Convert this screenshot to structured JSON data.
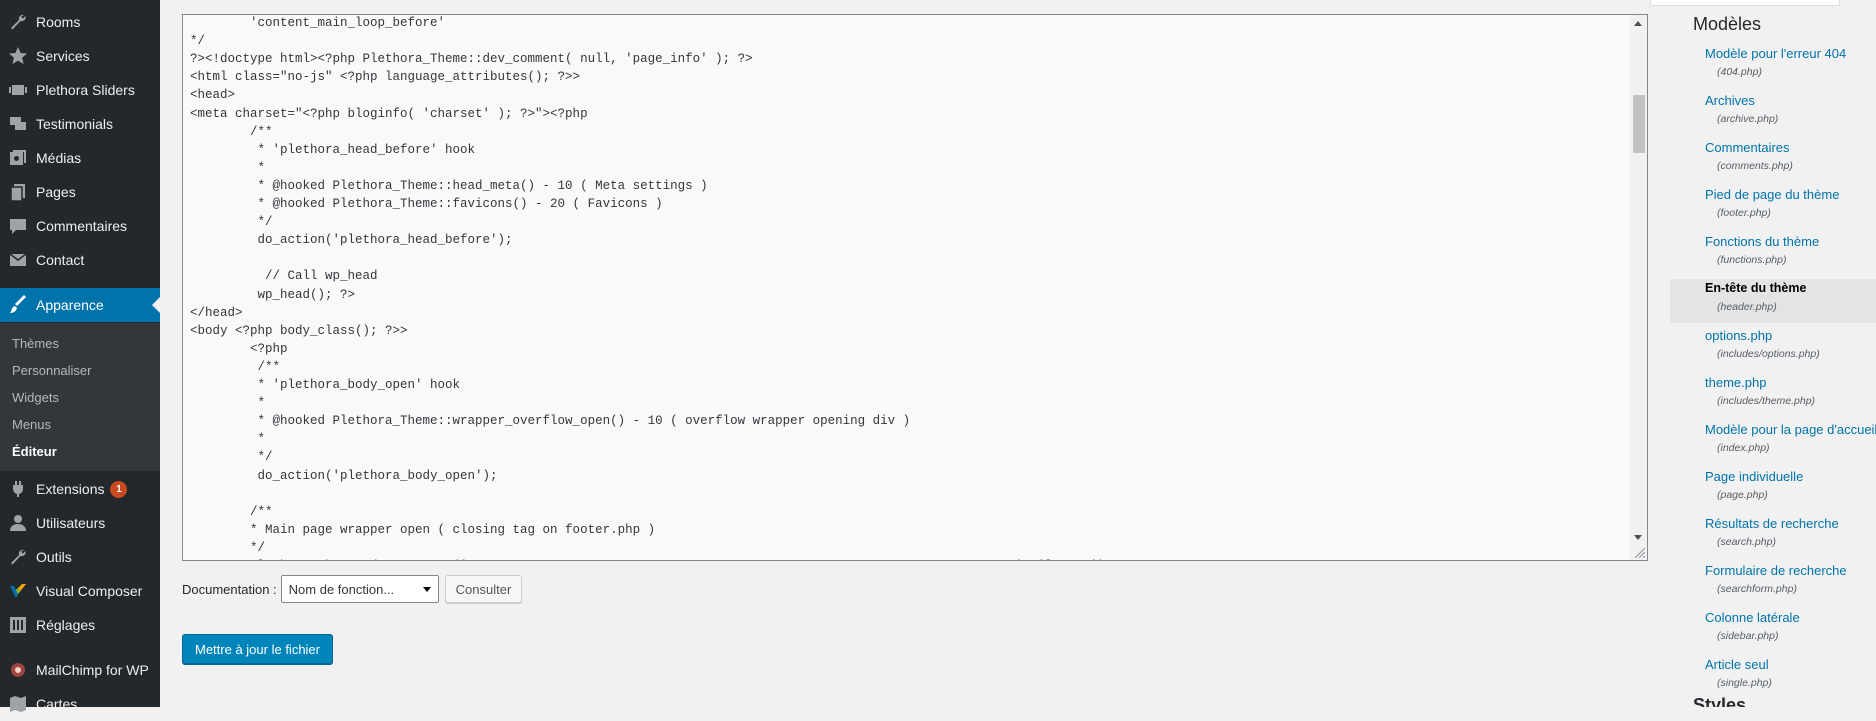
{
  "sidebar": {
    "items": [
      {
        "label": "Rooms",
        "icon": "wrench-icon"
      },
      {
        "label": "Services",
        "icon": "star-icon"
      },
      {
        "label": "Plethora Sliders",
        "icon": "slides-icon"
      },
      {
        "label": "Testimonials",
        "icon": "quote-icon"
      },
      {
        "label": "Médias",
        "icon": "media-icon"
      },
      {
        "label": "Pages",
        "icon": "pages-icon"
      },
      {
        "label": "Commentaires",
        "icon": "comment-icon"
      },
      {
        "label": "Contact",
        "icon": "mail-icon"
      },
      {
        "label": "Apparence",
        "icon": "brush-icon"
      },
      {
        "label": "Extensions",
        "icon": "plugin-icon",
        "badge": "1"
      },
      {
        "label": "Utilisateurs",
        "icon": "user-icon"
      },
      {
        "label": "Outils",
        "icon": "tools-icon"
      },
      {
        "label": "Visual Composer",
        "icon": "visual-composer-icon"
      },
      {
        "label": "Réglages",
        "icon": "settings-icon"
      },
      {
        "label": "MailChimp for WP",
        "icon": "mailchimp-icon"
      },
      {
        "label": "Cartes",
        "icon": "map-icon"
      }
    ],
    "submenu": [
      "Thèmes",
      "Personnaliser",
      "Widgets",
      "Menus",
      "Éditeur"
    ]
  },
  "editor": {
    "lines": [
      "        'content_main_loop_before'",
      "*/",
      "?><!doctype html><?php Plethora_Theme::dev_comment( null, 'page_info' ); ?>",
      "<html class=\"no-js\" <?php language_attributes(); ?>>",
      "<head>",
      "<meta charset=\"<?php bloginfo( 'charset' ); ?>\"><?php",
      "        /**",
      "         * 'plethora_head_before' hook",
      "         *",
      "         * @hooked Plethora_Theme::head_meta() - 10 ( Meta settings )",
      "         * @hooked Plethora_Theme::favicons() - 20 ( Favicons )",
      "         */",
      "         do_action('plethora_head_before');",
      "",
      "          // Call wp_head",
      "         wp_head(); ?>",
      "</head>",
      "<body <?php body_class(); ?>>",
      "        <?php",
      "         /**",
      "         * 'plethora_body_open' hook",
      "         *",
      "         * @hooked Plethora_Theme::wrapper_overflow_open() - 10 ( overflow wrapper opening div )",
      "         *",
      "         */",
      "         do_action('plethora_body_open');",
      "",
      "        /**",
      "        * Main page wrapper open ( closing tag on footer.php )",
      "        */",
      "        Plethora_Theme::dev_comment('  START ==                          PAGE WRAPPER                         ', 'layout');"
    ]
  },
  "documentation": {
    "label": "Documentation :",
    "select_value": "Nom de fonction...",
    "lookup_label": "Consulter"
  },
  "update_button": "Mettre à jour le fichier",
  "files_panel": {
    "title": "Modèles",
    "files": [
      {
        "name": "Modèle pour l'erreur 404",
        "path": "(404.php)"
      },
      {
        "name": "Archives",
        "path": "(archive.php)"
      },
      {
        "name": "Commentaires",
        "path": "(comments.php)"
      },
      {
        "name": "Pied de page du thème",
        "path": "(footer.php)"
      },
      {
        "name": "Fonctions du thème",
        "path": "(functions.php)"
      },
      {
        "name": "En-tête du thème",
        "path": "(header.php)"
      },
      {
        "name": "options.php",
        "path": "(includes/options.php)"
      },
      {
        "name": "theme.php",
        "path": "(includes/theme.php)"
      },
      {
        "name": "Modèle pour la page d'accueil",
        "path": "(index.php)"
      },
      {
        "name": "Page individuelle",
        "path": "(page.php)"
      },
      {
        "name": "Résultats de recherche",
        "path": "(search.php)"
      },
      {
        "name": "Formulaire de recherche",
        "path": "(searchform.php)"
      },
      {
        "name": "Colonne latérale",
        "path": "(sidebar.php)"
      },
      {
        "name": "Article seul",
        "path": "(single.php)"
      }
    ],
    "next_section": "Styles"
  },
  "colors": {
    "sidebar_bg": "#23282d",
    "accent": "#0073aa",
    "primary_button": "#0085ba",
    "badge": "#ca4a1f"
  }
}
